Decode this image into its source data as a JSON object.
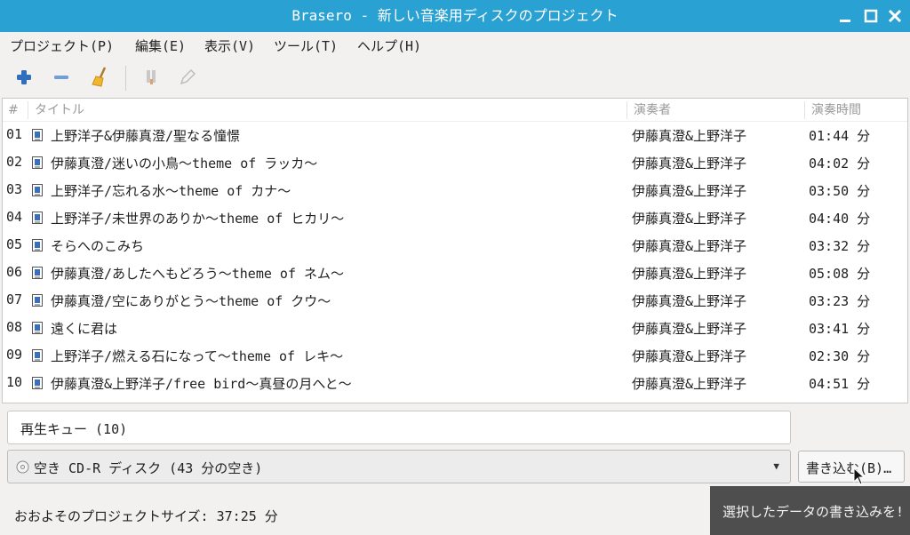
{
  "window": {
    "title": "Brasero - 新しい音楽用ディスクのプロジェクト"
  },
  "menu": [
    "プロジェクト(P)",
    "編集(E)",
    "表示(V)",
    "ツール(T)",
    "ヘルプ(H)"
  ],
  "toolbar": {
    "add_icon": "plus-icon",
    "remove_icon": "minus-icon",
    "clear_icon": "broom-icon",
    "split_icon": "split-icon",
    "edit_icon": "pencil-icon"
  },
  "table": {
    "headers": {
      "number": "#",
      "title": "タイトル",
      "artist": "演奏者",
      "duration": "演奏時間"
    },
    "rows": [
      {
        "number": "01",
        "title": "上野洋子&伊藤真澄/聖なる憧憬",
        "artist": "伊藤真澄&上野洋子",
        "duration": "01:44 分"
      },
      {
        "number": "02",
        "title": "伊藤真澄/迷いの小鳥～theme of ラッカ～",
        "artist": "伊藤真澄&上野洋子",
        "duration": "04:02 分"
      },
      {
        "number": "03",
        "title": "上野洋子/忘れる水～theme of カナ～",
        "artist": "伊藤真澄&上野洋子",
        "duration": "03:50 分"
      },
      {
        "number": "04",
        "title": "上野洋子/未世界のありか～theme of ヒカリ～",
        "artist": "伊藤真澄&上野洋子",
        "duration": "04:40 分"
      },
      {
        "number": "05",
        "title": "そらへのこみち",
        "artist": "伊藤真澄&上野洋子",
        "duration": "03:32 分"
      },
      {
        "number": "06",
        "title": "伊藤真澄/あしたへもどろう～theme of ネム～",
        "artist": "伊藤真澄&上野洋子",
        "duration": "05:08 分"
      },
      {
        "number": "07",
        "title": "伊藤真澄/空にありがとう～theme of クウ～",
        "artist": "伊藤真澄&上野洋子",
        "duration": "03:23 分"
      },
      {
        "number": "08",
        "title": "遠くに君は",
        "artist": "伊藤真澄&上野洋子",
        "duration": "03:41 分"
      },
      {
        "number": "09",
        "title": "上野洋子/燃える石になって～theme of レキ～",
        "artist": "伊藤真澄&上野洋子",
        "duration": "02:30 分"
      },
      {
        "number": "10",
        "title": "伊藤真澄&上野洋子/free bird～真昼の月へと～",
        "artist": "伊藤真澄&上野洋子",
        "duration": "04:51 分"
      }
    ]
  },
  "queue": {
    "label": "再生キュー (10)"
  },
  "disc": {
    "selected": "空き CD-R ディスク (43 分の空き)"
  },
  "burn_button": {
    "label": "書き込む(B)…"
  },
  "status": {
    "size_text": "おおよそのプロジェクトサイズ: 37:25 分"
  },
  "tooltip": {
    "text": "選択したデータの書き込みを!"
  },
  "colors": {
    "titlebar": "#2aa1d3",
    "tooltip_bg": "#4e4e4e"
  }
}
